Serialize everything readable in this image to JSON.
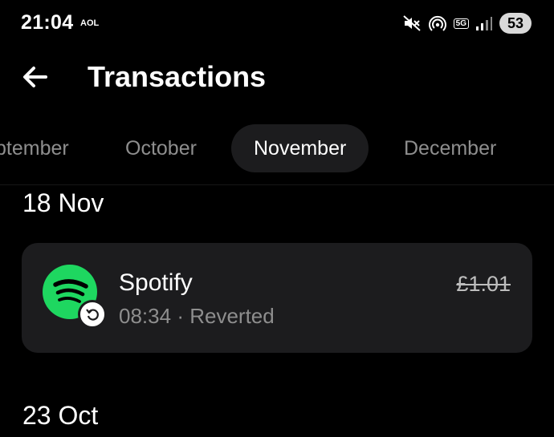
{
  "status_bar": {
    "time": "21:04",
    "carrier": "AOL",
    "network": "5G",
    "battery": "53",
    "icons": [
      "mute-icon",
      "hotspot-icon",
      "network-5g-icon",
      "signal-icon",
      "battery-icon"
    ]
  },
  "header": {
    "back_icon": "arrow-left-icon",
    "title": "Transactions"
  },
  "months": {
    "tabs": [
      {
        "label": "ptember",
        "selected": false
      },
      {
        "label": "October",
        "selected": false
      },
      {
        "label": "November",
        "selected": true
      },
      {
        "label": "December",
        "selected": false
      }
    ]
  },
  "groups": [
    {
      "date": "18 Nov",
      "transactions": [
        {
          "merchant": "Spotify",
          "time": "08:34",
          "separator": "·",
          "status": "Reverted",
          "amount": "£1.01",
          "icon": "spotify-logo-icon",
          "badge_icon": "revert-icon"
        }
      ]
    },
    {
      "date": "23 Oct",
      "transactions": []
    }
  ],
  "colors": {
    "background": "#000000",
    "card": "#1c1c1e",
    "selected_tab": "#1c1c1e",
    "muted_text": "#8e8e8e",
    "spotify_green": "#1ed760"
  }
}
